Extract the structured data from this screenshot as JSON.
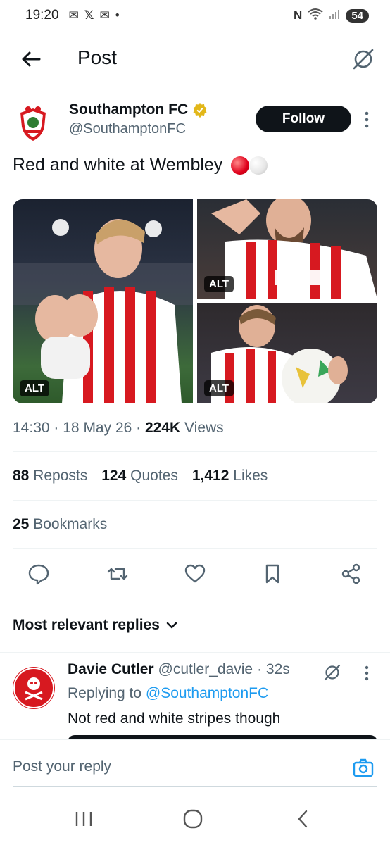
{
  "status_bar": {
    "time": "19:20",
    "notification_icons": [
      "mail-icon",
      "x-icon",
      "mail-icon"
    ],
    "dot": "•",
    "battery": "54"
  },
  "header": {
    "title": "Post"
  },
  "post": {
    "author_name": "Southampton FC",
    "author_handle": "@SouthamptonFC",
    "follow_label": "Follow",
    "text": "Red and white at Wembley",
    "media_alt_labels": [
      "ALT",
      "ALT",
      "ALT"
    ],
    "time": "14:30",
    "date": "18 May 26",
    "views_count": "224K",
    "views_label": "Views",
    "reposts_count": "88",
    "reposts_label": "Reposts",
    "quotes_count": "124",
    "quotes_label": "Quotes",
    "likes_count": "1,412",
    "likes_label": "Likes",
    "bookmarks_count": "25",
    "bookmarks_label": "Bookmarks",
    "separator": "·"
  },
  "replies": {
    "sort_label": "Most relevant replies",
    "items": [
      {
        "name": "Davie Cutler",
        "handle": "@cutler_davie",
        "time": "· 32s",
        "replying_prefix": "Replying to",
        "replying_handle": "@SouthamptonFC",
        "text": "Not red and white stripes though"
      }
    ]
  },
  "composer": {
    "placeholder": "Post your reply"
  },
  "colors": {
    "accent": "#1d9bf0",
    "text": "#0f1419",
    "muted": "#536471",
    "verified_gold": "#e2b719"
  }
}
